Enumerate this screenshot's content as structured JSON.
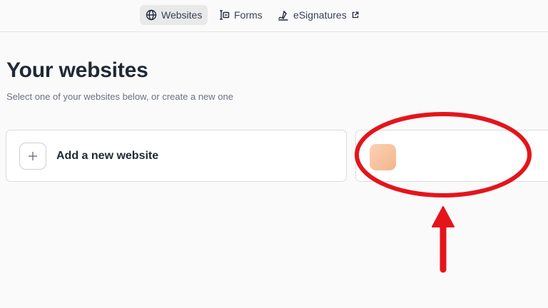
{
  "nav": {
    "items": [
      {
        "label": "Websites",
        "icon": "globe-icon",
        "active": true
      },
      {
        "label": "Forms",
        "icon": "form-icon",
        "active": false
      },
      {
        "label": "eSignatures",
        "icon": "signature-icon",
        "external": true,
        "active": false
      }
    ]
  },
  "main": {
    "title": "Your websites",
    "subtitle": "Select one of your websites below, or create a new one",
    "add_card": {
      "label": "Add a new website",
      "icon": "plus-icon"
    },
    "site_card": {
      "thumbnail_icon": "site-thumbnail",
      "thumbnail_color": "#f5b48c"
    }
  },
  "annotation": {
    "color": "#e5141b",
    "shapes": [
      "ellipse-highlight",
      "arrow-up"
    ]
  }
}
